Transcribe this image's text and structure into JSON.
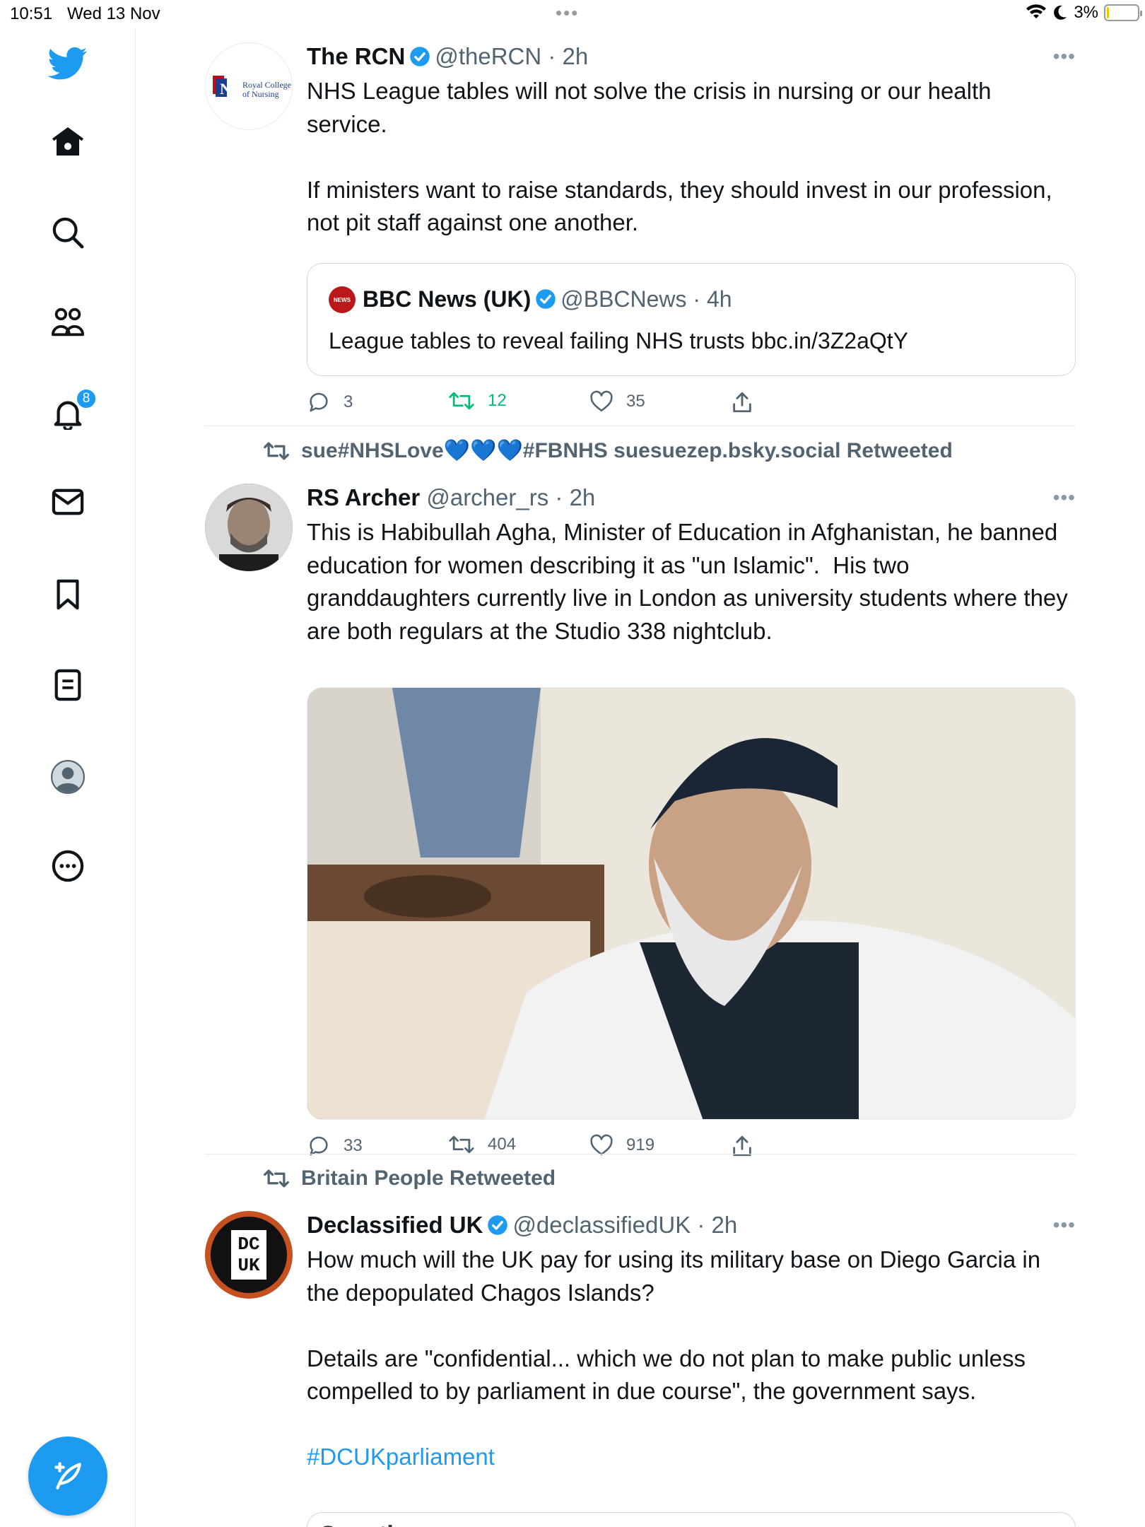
{
  "status": {
    "time": "10:51",
    "date": "Wed 13 Nov",
    "battery": "3%",
    "battery_level": 0.03
  },
  "sidebar": {
    "items": [
      {
        "label": "Twitter",
        "icon": "twitter-bird-icon"
      },
      {
        "label": "Home",
        "icon": "home-icon"
      },
      {
        "label": "Explore",
        "icon": "search-icon"
      },
      {
        "label": "Communities",
        "icon": "communities-icon"
      },
      {
        "label": "Notifications",
        "icon": "bell-icon"
      },
      {
        "label": "Messages",
        "icon": "mail-icon"
      },
      {
        "label": "Bookmarks",
        "icon": "bookmark-icon"
      },
      {
        "label": "Lists",
        "icon": "list-icon"
      },
      {
        "label": "Profile",
        "icon": "profile-icon"
      },
      {
        "label": "More",
        "icon": "more-circle-icon"
      }
    ],
    "notifications_badge": "8",
    "compose_icon": "compose-feather-icon"
  },
  "tweets": [
    {
      "name": "The RCN",
      "handle": "@theRCN",
      "time": "2h",
      "text": "NHS League tables will not solve the crisis in nursing or our health service.\n\nIf ministers want to raise standards, they should invest in our profession, not pit staff against one another.",
      "avatar_lines": [
        "Royal College",
        "of Nursing"
      ],
      "quote": {
        "name": "BBC News (UK)",
        "handle": "@BBCNews",
        "time": "4h",
        "text": "League tables to reveal failing NHS trusts bbc.in/3Z2aQtY",
        "badge_text": "NEWS"
      },
      "replies": "3",
      "retweets": "12",
      "likes": "35"
    },
    {
      "retweeted_by": "sue#NHSLove💙💙💙#FBNHS suesuezep.bsky.social Retweeted",
      "name": "RS Archer",
      "handle": "@archer_rs",
      "time": "2h",
      "text": "This is Habibullah Agha, Minister of Education in Afghanistan, he banned education for women describing it as \"un Islamic\".  His two granddaughters currently live in London as university students where they are both regulars at the Studio 338 nightclub.",
      "replies": "33",
      "retweets": "404",
      "likes": "919"
    },
    {
      "retweeted_by": "Britain People Retweeted",
      "name": "Declassified UK",
      "handle": "@declassifiedUK",
      "time": "2h",
      "text": "How much will the UK pay for using its military base on Diego Garcia in the depopulated Chagos Islands?\n\nDetails are \"confidential... which we do not plan to make public unless compelled to by parliament in due course\", the government says.",
      "hashtag": "#DCUKparliament",
      "avatar_lines": [
        "DC",
        "UK"
      ],
      "card_label": "Question"
    }
  ]
}
